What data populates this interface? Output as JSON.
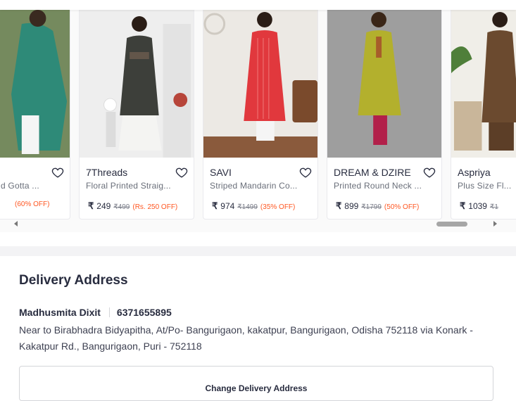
{
  "products": [
    {
      "brand": "",
      "description": "d Gotta ...",
      "price": "",
      "mrp": "",
      "discount": "(60% OFF)",
      "image_colors": {
        "bg": "#6b7e57",
        "dress": "#2e8a78",
        "accent": "#c9a26a"
      }
    },
    {
      "brand": "7Threads",
      "description": "Floral Printed Straig...",
      "price": "249",
      "mrp": "₹499",
      "discount": "(Rs. 250 OFF)",
      "image_colors": {
        "bg": "#eeeeee",
        "dress": "#3d3f3a",
        "accent": "#b7453a"
      }
    },
    {
      "brand": "SAVI",
      "description": "Striped Mandarin Co...",
      "price": "974",
      "mrp": "₹1499",
      "discount": "(35% OFF)",
      "image_colors": {
        "bg": "#ece9e4",
        "dress": "#e1383d",
        "accent": "#8a5a3c"
      }
    },
    {
      "brand": "DREAM & DZIRE",
      "description": "Printed Round Neck ...",
      "price": "899",
      "mrp": "₹1799",
      "discount": "(50% OFF)",
      "image_colors": {
        "bg": "#9e9e9e",
        "dress": "#b3b02d",
        "accent": "#b2204a"
      }
    },
    {
      "brand": "Aspriya",
      "description": "Plus Size Fl...",
      "price": "1039",
      "mrp": "₹1",
      "discount": "",
      "image_colors": {
        "bg": "#f0eee8",
        "dress": "#6b4a2f",
        "accent": "#4f7f3a"
      }
    }
  ],
  "currency_symbol": "₹",
  "icons": {
    "wishlist": "heart-outline-icon",
    "scroll_left": "arrow-left-icon",
    "scroll_right": "arrow-right-icon"
  },
  "colors": {
    "discount": "#ff5722",
    "text": "#282c3f",
    "muted": "#696e79"
  },
  "delivery": {
    "title": "Delivery Address",
    "name": "Madhusmita Dixit",
    "phone": "6371655895",
    "address": "Near to Birabhadra Bidyapitha, At/Po- Bangurigaon, kakatpur, Bangurigaon, Odisha 752118 via Konark - Kakatpur Rd., Bangurigaon, Puri - 752118",
    "change_label": "Change Delivery Address"
  }
}
